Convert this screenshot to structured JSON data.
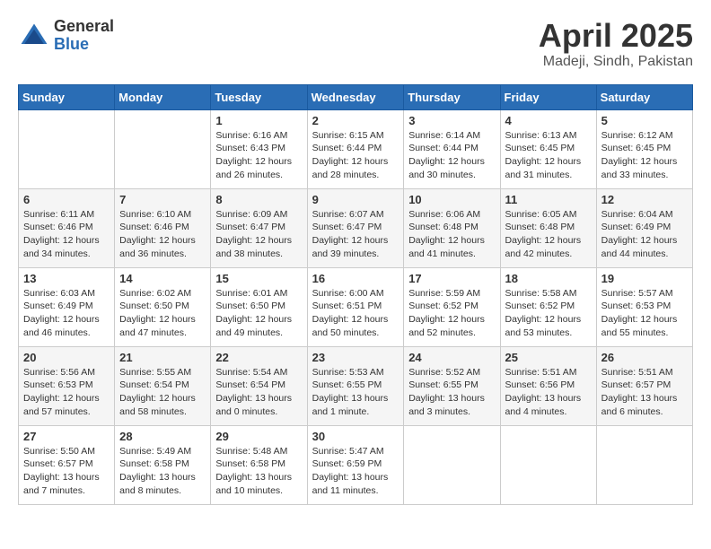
{
  "header": {
    "logo_general": "General",
    "logo_blue": "Blue",
    "month_title": "April 2025",
    "location": "Madeji, Sindh, Pakistan"
  },
  "days_of_week": [
    "Sunday",
    "Monday",
    "Tuesday",
    "Wednesday",
    "Thursday",
    "Friday",
    "Saturday"
  ],
  "weeks": [
    [
      {
        "day": "",
        "info": ""
      },
      {
        "day": "",
        "info": ""
      },
      {
        "day": "1",
        "sunrise": "6:16 AM",
        "sunset": "6:43 PM",
        "daylight": "12 hours and 26 minutes."
      },
      {
        "day": "2",
        "sunrise": "6:15 AM",
        "sunset": "6:44 PM",
        "daylight": "12 hours and 28 minutes."
      },
      {
        "day": "3",
        "sunrise": "6:14 AM",
        "sunset": "6:44 PM",
        "daylight": "12 hours and 30 minutes."
      },
      {
        "day": "4",
        "sunrise": "6:13 AM",
        "sunset": "6:45 PM",
        "daylight": "12 hours and 31 minutes."
      },
      {
        "day": "5",
        "sunrise": "6:12 AM",
        "sunset": "6:45 PM",
        "daylight": "12 hours and 33 minutes."
      }
    ],
    [
      {
        "day": "6",
        "sunrise": "6:11 AM",
        "sunset": "6:46 PM",
        "daylight": "12 hours and 34 minutes."
      },
      {
        "day": "7",
        "sunrise": "6:10 AM",
        "sunset": "6:46 PM",
        "daylight": "12 hours and 36 minutes."
      },
      {
        "day": "8",
        "sunrise": "6:09 AM",
        "sunset": "6:47 PM",
        "daylight": "12 hours and 38 minutes."
      },
      {
        "day": "9",
        "sunrise": "6:07 AM",
        "sunset": "6:47 PM",
        "daylight": "12 hours and 39 minutes."
      },
      {
        "day": "10",
        "sunrise": "6:06 AM",
        "sunset": "6:48 PM",
        "daylight": "12 hours and 41 minutes."
      },
      {
        "day": "11",
        "sunrise": "6:05 AM",
        "sunset": "6:48 PM",
        "daylight": "12 hours and 42 minutes."
      },
      {
        "day": "12",
        "sunrise": "6:04 AM",
        "sunset": "6:49 PM",
        "daylight": "12 hours and 44 minutes."
      }
    ],
    [
      {
        "day": "13",
        "sunrise": "6:03 AM",
        "sunset": "6:49 PM",
        "daylight": "12 hours and 46 minutes."
      },
      {
        "day": "14",
        "sunrise": "6:02 AM",
        "sunset": "6:50 PM",
        "daylight": "12 hours and 47 minutes."
      },
      {
        "day": "15",
        "sunrise": "6:01 AM",
        "sunset": "6:50 PM",
        "daylight": "12 hours and 49 minutes."
      },
      {
        "day": "16",
        "sunrise": "6:00 AM",
        "sunset": "6:51 PM",
        "daylight": "12 hours and 50 minutes."
      },
      {
        "day": "17",
        "sunrise": "5:59 AM",
        "sunset": "6:52 PM",
        "daylight": "12 hours and 52 minutes."
      },
      {
        "day": "18",
        "sunrise": "5:58 AM",
        "sunset": "6:52 PM",
        "daylight": "12 hours and 53 minutes."
      },
      {
        "day": "19",
        "sunrise": "5:57 AM",
        "sunset": "6:53 PM",
        "daylight": "12 hours and 55 minutes."
      }
    ],
    [
      {
        "day": "20",
        "sunrise": "5:56 AM",
        "sunset": "6:53 PM",
        "daylight": "12 hours and 57 minutes."
      },
      {
        "day": "21",
        "sunrise": "5:55 AM",
        "sunset": "6:54 PM",
        "daylight": "12 hours and 58 minutes."
      },
      {
        "day": "22",
        "sunrise": "5:54 AM",
        "sunset": "6:54 PM",
        "daylight": "13 hours and 0 minutes."
      },
      {
        "day": "23",
        "sunrise": "5:53 AM",
        "sunset": "6:55 PM",
        "daylight": "13 hours and 1 minute."
      },
      {
        "day": "24",
        "sunrise": "5:52 AM",
        "sunset": "6:55 PM",
        "daylight": "13 hours and 3 minutes."
      },
      {
        "day": "25",
        "sunrise": "5:51 AM",
        "sunset": "6:56 PM",
        "daylight": "13 hours and 4 minutes."
      },
      {
        "day": "26",
        "sunrise": "5:51 AM",
        "sunset": "6:57 PM",
        "daylight": "13 hours and 6 minutes."
      }
    ],
    [
      {
        "day": "27",
        "sunrise": "5:50 AM",
        "sunset": "6:57 PM",
        "daylight": "13 hours and 7 minutes."
      },
      {
        "day": "28",
        "sunrise": "5:49 AM",
        "sunset": "6:58 PM",
        "daylight": "13 hours and 8 minutes."
      },
      {
        "day": "29",
        "sunrise": "5:48 AM",
        "sunset": "6:58 PM",
        "daylight": "13 hours and 10 minutes."
      },
      {
        "day": "30",
        "sunrise": "5:47 AM",
        "sunset": "6:59 PM",
        "daylight": "13 hours and 11 minutes."
      },
      {
        "day": "",
        "info": ""
      },
      {
        "day": "",
        "info": ""
      },
      {
        "day": "",
        "info": ""
      }
    ]
  ]
}
